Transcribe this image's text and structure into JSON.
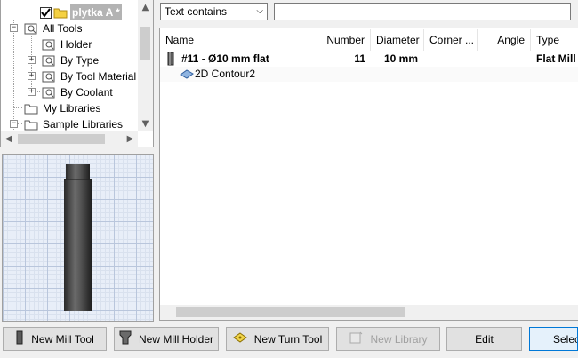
{
  "tree": {
    "items": [
      {
        "label": "plytka A *",
        "selected": true
      },
      {
        "label": "All Tools"
      },
      {
        "label": "Holder"
      },
      {
        "label": "By Type"
      },
      {
        "label": "By Tool Material"
      },
      {
        "label": "By Coolant"
      },
      {
        "label": "My Libraries"
      },
      {
        "label": "Sample Libraries"
      }
    ],
    "expander_collapsed": "+",
    "expander_expanded": "−"
  },
  "filter": {
    "mode": "Text contains",
    "search_value": "",
    "chevron": "⌵"
  },
  "table": {
    "columns": [
      "Name",
      "Number",
      "Diameter",
      "Corner ...",
      "Angle",
      "Type"
    ],
    "rows": [
      {
        "name": "#11 - Ø10 mm flat",
        "number": "11",
        "diameter": "10 mm",
        "corner": "",
        "angle": "",
        "type": "Flat Mill"
      },
      {
        "name": "2D Contour2"
      }
    ]
  },
  "buttons": {
    "new_mill_tool": "New Mill Tool",
    "new_mill_holder": "New Mill Holder",
    "new_turn_tool": "New Turn Tool",
    "new_library": "New Library",
    "edit": "Edit",
    "select": "Select"
  },
  "scroll_glyphs": {
    "up": "▲",
    "down": "▼",
    "left": "◀",
    "right": "▶"
  },
  "colors": {
    "selection": "#b3b3b3",
    "grid": "#b9c6dc",
    "focus_border": "#0078d7",
    "tool_body": "#4a4a4a"
  }
}
